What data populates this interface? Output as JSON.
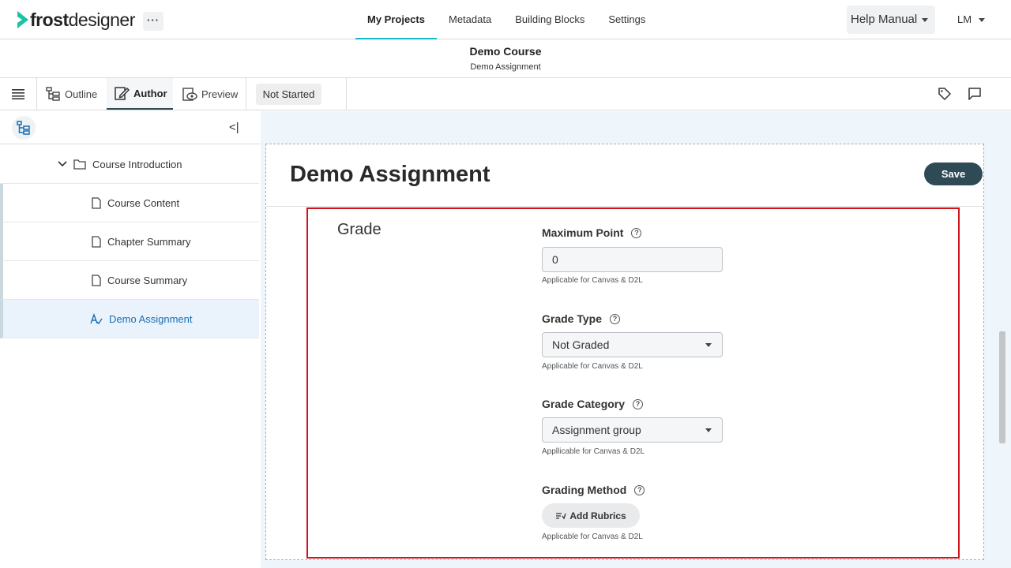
{
  "app": {
    "logo_bold": "frost",
    "logo_light": "designer",
    "more_label": "···"
  },
  "nav": {
    "links": [
      "My Projects",
      "Metadata",
      "Building Blocks",
      "Settings"
    ],
    "active": "My Projects",
    "help_label": "Help Manual",
    "user_initials": "LM",
    "accent_color": "#19b8c9"
  },
  "course": {
    "title": "Demo Course",
    "subtitle": "Demo Assignment"
  },
  "toolbar": {
    "tabs": [
      "Outline",
      "Author",
      "Preview"
    ],
    "active_tab": "Author",
    "status": "Not Started",
    "icons": [
      "menu-icon",
      "outline-icon",
      "author-icon",
      "preview-icon",
      "tag-icon",
      "comment-icon"
    ]
  },
  "sidebar": {
    "collapse_label": "<|",
    "items": [
      {
        "label": "Course Introduction",
        "type": "folder",
        "icon": "folder-icon"
      },
      {
        "label": "Course Content",
        "type": "page",
        "icon": "page-icon"
      },
      {
        "label": "Chapter Summary",
        "type": "page",
        "icon": "page-icon"
      },
      {
        "label": "Course Summary",
        "type": "page",
        "icon": "page-icon"
      },
      {
        "label": "Demo Assignment",
        "type": "assignment",
        "icon": "assignment-icon",
        "active": true
      }
    ]
  },
  "editor": {
    "title": "Demo Assignment",
    "save_label": "Save",
    "section_label": "Grade",
    "fields": {
      "max_point": {
        "label": "Maximum Point",
        "value": "0",
        "hint": "Applicable for Canvas & D2L"
      },
      "grade_type": {
        "label": "Grade Type",
        "value": "Not Graded",
        "hint": "Applicable for Canvas & D2L"
      },
      "grade_category": {
        "label": "Grade Category",
        "value": "Assignment group",
        "hint": "Appllicable for Canvas & D2L"
      },
      "grading_method": {
        "label": "Grading Method",
        "button_label": "Add Rubrics",
        "hint": "Applicable for Canvas & D2L"
      }
    },
    "help_glyph": "?",
    "highlight_color": "#d0141c",
    "save_color": "#2d4a55"
  }
}
